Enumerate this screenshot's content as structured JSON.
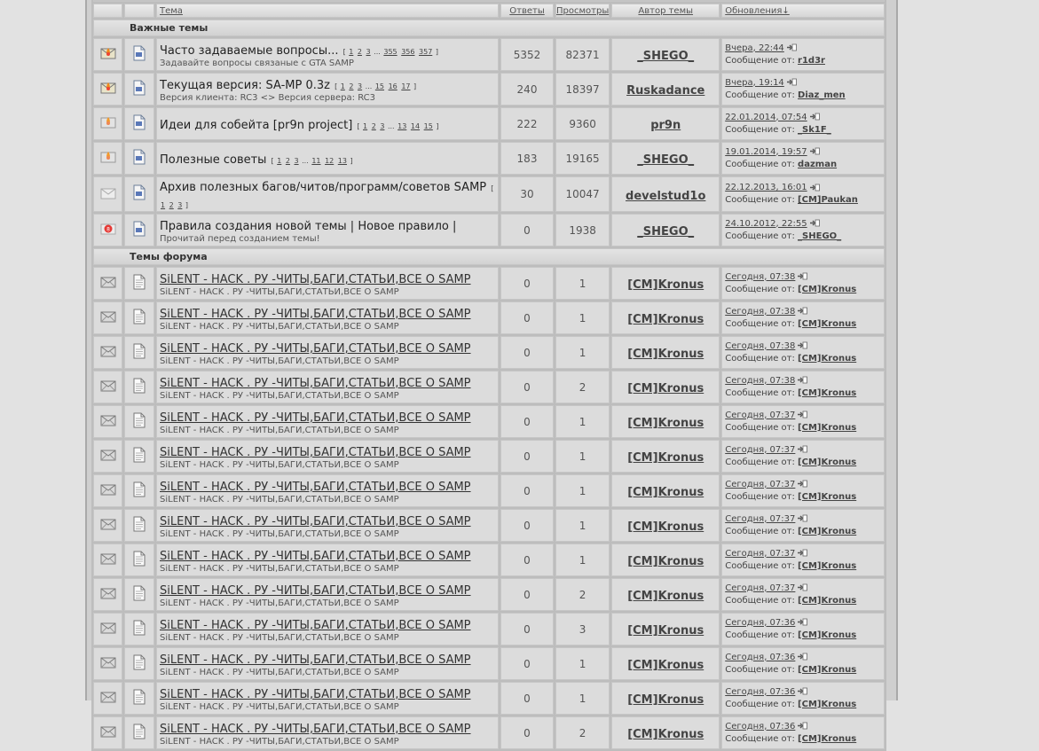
{
  "header": {
    "topic": "Тема",
    "replies": "Ответы",
    "views": "Просмотры",
    "author": "Автор темы",
    "updates": "Обновления↓"
  },
  "sections": {
    "important": "Важные темы",
    "forum": "Темы форума"
  },
  "labels": {
    "message_from": "Сообщение от:"
  },
  "important_topics": [
    {
      "icon": "hot-announce-icon",
      "title": "Часто задаваемые вопросы...",
      "pages_open": "[",
      "pages": [
        "1",
        "2",
        "3",
        "...",
        "355",
        "356",
        "357"
      ],
      "pages_close": "]",
      "desc": "Задавайте вопросы связаные с GTA SAMP",
      "replies": "5352",
      "views": "82371",
      "author": "_SHEGO_",
      "date": "Вчера, 22:44",
      "last_user": "r1d3r"
    },
    {
      "icon": "hot-announce-icon",
      "title": "Текущая версия: SA-MP 0.3z",
      "pages_open": "[",
      "pages": [
        "1",
        "2",
        "3",
        "...",
        "15",
        "16",
        "17"
      ],
      "pages_close": "]",
      "desc": "Версия клиента: RC3 <> Версия сервера: RC3",
      "replies": "240",
      "views": "18397",
      "author": "Ruskadance",
      "date": "Вчера, 19:14",
      "last_user": "Diaz_men"
    },
    {
      "icon": "hot-sticky-icon",
      "title": "Идеи для собейта [pr9n project]",
      "pages_open": "[",
      "pages": [
        "1",
        "2",
        "3",
        "...",
        "13",
        "14",
        "15"
      ],
      "pages_close": "]",
      "desc": "",
      "replies": "222",
      "views": "9360",
      "author": "pr9n",
      "date": "22.01.2014, 07:54",
      "last_user": "_Sk1F_"
    },
    {
      "icon": "hot-sticky-icon",
      "title": "Полезные советы",
      "pages_open": "[",
      "pages": [
        "1",
        "2",
        "3",
        "...",
        "11",
        "12",
        "13"
      ],
      "pages_close": "]",
      "desc": "",
      "replies": "183",
      "views": "19165",
      "author": "_SHEGO_",
      "date": "19.01.2014, 19:57",
      "last_user": "dazman"
    },
    {
      "icon": "sticky-icon",
      "title": "Архив полезных багов/читов/программ/советов SAMP",
      "pages_open": "[",
      "pages": [
        "1",
        "2",
        "3"
      ],
      "pages_close": "]",
      "desc": "",
      "replies": "30",
      "views": "10047",
      "author": "develstud1o",
      "date": "22.12.2013, 16:01",
      "last_user": "[CM]Paukan"
    },
    {
      "icon": "closed-icon",
      "title": "Правила создания новой темы | Новое правило |",
      "pages_open": "",
      "pages": [],
      "pages_close": "",
      "desc": "Прочитай перед созданием темы!",
      "replies": "0",
      "views": "1938",
      "author": "_SHEGO_",
      "date": "24.10.2012, 22:55",
      "last_user": "_SHEGO_"
    }
  ],
  "forum_topics": [
    {
      "title": "SiLENT - HACK . РУ -ЧИТЫ,БАГИ,СТАТЬИ,ВСЕ О SAMP",
      "desc": "SiLENT - HACK . РУ -ЧИТЫ,БАГИ,СТАТЬИ,ВСЕ О SAMP",
      "replies": "0",
      "views": "1",
      "author": "[CM]Kronus",
      "date": "Сегодня, 07:38",
      "last_user": "[CM]Kronus"
    },
    {
      "title": "SiLENT - HACK . РУ -ЧИТЫ,БАГИ,СТАТЬИ,ВСЕ О SAMP",
      "desc": "SiLENT - HACK . РУ -ЧИТЫ,БАГИ,СТАТЬИ,ВСЕ О SAMP",
      "replies": "0",
      "views": "1",
      "author": "[CM]Kronus",
      "date": "Сегодня, 07:38",
      "last_user": "[CM]Kronus"
    },
    {
      "title": "SiLENT - HACK . РУ -ЧИТЫ,БАГИ,СТАТЬИ,ВСЕ О SAMP",
      "desc": "SiLENT - HACK . РУ -ЧИТЫ,БАГИ,СТАТЬИ,ВСЕ О SAMP",
      "replies": "0",
      "views": "1",
      "author": "[CM]Kronus",
      "date": "Сегодня, 07:38",
      "last_user": "[CM]Kronus"
    },
    {
      "title": "SiLENT - HACK . РУ -ЧИТЫ,БАГИ,СТАТЬИ,ВСЕ О SAMP",
      "desc": "SiLENT - HACK . РУ -ЧИТЫ,БАГИ,СТАТЬИ,ВСЕ О SAMP",
      "replies": "0",
      "views": "2",
      "author": "[CM]Kronus",
      "date": "Сегодня, 07:38",
      "last_user": "[CM]Kronus"
    },
    {
      "title": "SiLENT - HACK . РУ -ЧИТЫ,БАГИ,СТАТЬИ,ВСЕ О SAMP",
      "desc": "SiLENT - HACK . РУ -ЧИТЫ,БАГИ,СТАТЬИ,ВСЕ О SAMP",
      "replies": "0",
      "views": "1",
      "author": "[CM]Kronus",
      "date": "Сегодня, 07:37",
      "last_user": "[CM]Kronus"
    },
    {
      "title": "SiLENT - HACK . РУ -ЧИТЫ,БАГИ,СТАТЬИ,ВСЕ О SAMP",
      "desc": "SiLENT - HACK . РУ -ЧИТЫ,БАГИ,СТАТЬИ,ВСЕ О SAMP",
      "replies": "0",
      "views": "1",
      "author": "[CM]Kronus",
      "date": "Сегодня, 07:37",
      "last_user": "[CM]Kronus"
    },
    {
      "title": "SiLENT - HACK . РУ -ЧИТЫ,БАГИ,СТАТЬИ,ВСЕ О SAMP",
      "desc": "SiLENT - HACK . РУ -ЧИТЫ,БАГИ,СТАТЬИ,ВСЕ О SAMP",
      "replies": "0",
      "views": "1",
      "author": "[CM]Kronus",
      "date": "Сегодня, 07:37",
      "last_user": "[CM]Kronus"
    },
    {
      "title": "SiLENT - HACK . РУ -ЧИТЫ,БАГИ,СТАТЬИ,ВСЕ О SAMP",
      "desc": "SiLENT - HACK . РУ -ЧИТЫ,БАГИ,СТАТЬИ,ВСЕ О SAMP",
      "replies": "0",
      "views": "1",
      "author": "[CM]Kronus",
      "date": "Сегодня, 07:37",
      "last_user": "[CM]Kronus"
    },
    {
      "title": "SiLENT - HACK . РУ -ЧИТЫ,БАГИ,СТАТЬИ,ВСЕ О SAMP",
      "desc": "SiLENT - HACK . РУ -ЧИТЫ,БАГИ,СТАТЬИ,ВСЕ О SAMP",
      "replies": "0",
      "views": "1",
      "author": "[CM]Kronus",
      "date": "Сегодня, 07:37",
      "last_user": "[CM]Kronus"
    },
    {
      "title": "SiLENT - HACK . РУ -ЧИТЫ,БАГИ,СТАТЬИ,ВСЕ О SAMP",
      "desc": "SiLENT - HACK . РУ -ЧИТЫ,БАГИ,СТАТЬИ,ВСЕ О SAMP",
      "replies": "0",
      "views": "2",
      "author": "[CM]Kronus",
      "date": "Сегодня, 07:37",
      "last_user": "[CM]Kronus"
    },
    {
      "title": "SiLENT - HACK . РУ -ЧИТЫ,БАГИ,СТАТЬИ,ВСЕ О SAMP",
      "desc": "SiLENT - HACK . РУ -ЧИТЫ,БАГИ,СТАТЬИ,ВСЕ О SAMP",
      "replies": "0",
      "views": "3",
      "author": "[CM]Kronus",
      "date": "Сегодня, 07:36",
      "last_user": "[CM]Kronus"
    },
    {
      "title": "SiLENT - HACK . РУ -ЧИТЫ,БАГИ,СТАТЬИ,ВСЕ О SAMP",
      "desc": "SiLENT - HACK . РУ -ЧИТЫ,БАГИ,СТАТЬИ,ВСЕ О SAMP",
      "replies": "0",
      "views": "1",
      "author": "[CM]Kronus",
      "date": "Сегодня, 07:36",
      "last_user": "[CM]Kronus"
    },
    {
      "title": "SiLENT - HACK . РУ -ЧИТЫ,БАГИ,СТАТЬИ,ВСЕ О SAMP",
      "desc": "SiLENT - HACK . РУ -ЧИТЫ,БАГИ,СТАТЬИ,ВСЕ О SAMP",
      "replies": "0",
      "views": "1",
      "author": "[CM]Kronus",
      "date": "Сегодня, 07:36",
      "last_user": "[CM]Kronus"
    },
    {
      "title": "SiLENT - HACK . РУ -ЧИТЫ,БАГИ,СТАТЬИ,ВСЕ О SAMP",
      "desc": "SiLENT - HACK . РУ -ЧИТЫ,БАГИ,СТАТЬИ,ВСЕ О SAMP",
      "replies": "0",
      "views": "2",
      "author": "[CM]Kronus",
      "date": "Сегодня, 07:36",
      "last_user": "[CM]Kronus"
    }
  ]
}
